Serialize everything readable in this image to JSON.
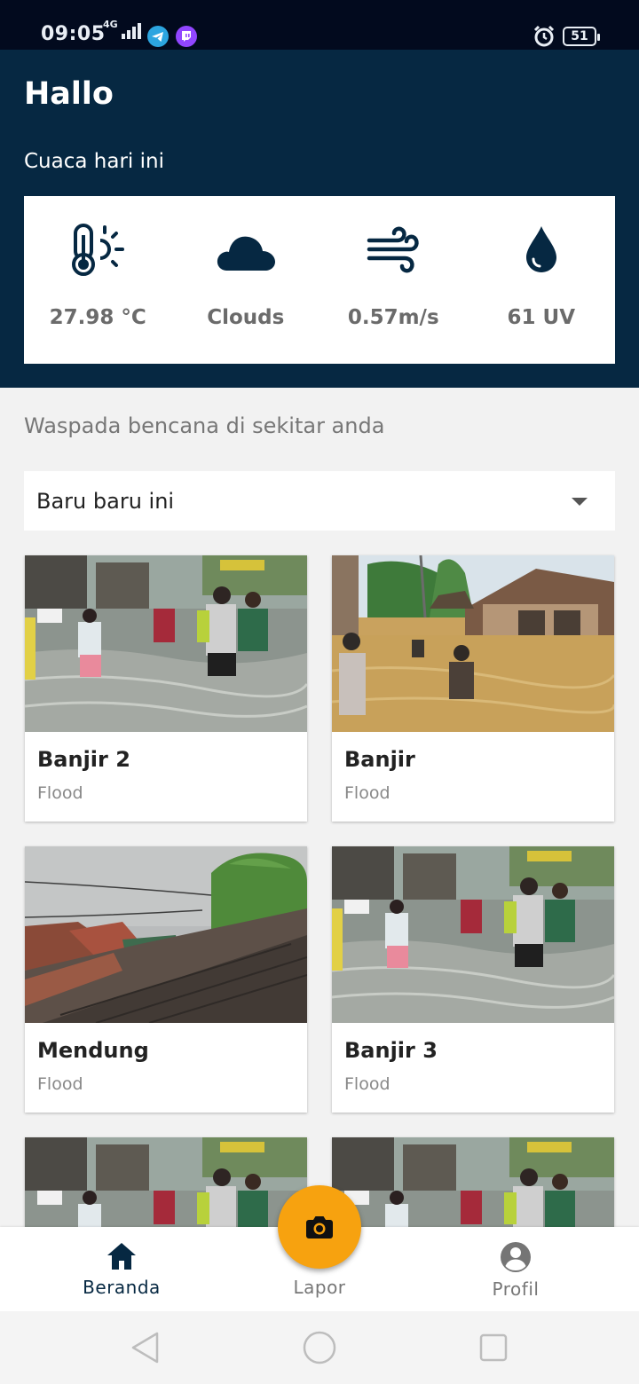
{
  "status": {
    "time": "09:05",
    "network": "4G",
    "battery": "51"
  },
  "header": {
    "greeting": "Hallo",
    "weather_title": "Cuaca hari ini"
  },
  "weather": [
    {
      "icon": "thermometer-sun-icon",
      "value": "27.98 °C"
    },
    {
      "icon": "cloud-icon",
      "value": "Clouds"
    },
    {
      "icon": "wind-icon",
      "value": "0.57m/s"
    },
    {
      "icon": "water-drop-icon",
      "value": "61 UV"
    }
  ],
  "section": {
    "alert_text": "Waspada bencana di sekitar anda",
    "filter_selected": "Baru baru ini"
  },
  "cards": [
    {
      "title": "Banjir 2",
      "subtitle": "Flood",
      "image": "flood-street-photo"
    },
    {
      "title": "Banjir",
      "subtitle": "Flood",
      "image": "flood-village-photo"
    },
    {
      "title": "Mendung",
      "subtitle": "Flood",
      "image": "cloudy-roof-photo"
    },
    {
      "title": "Banjir 3",
      "subtitle": "Flood",
      "image": "flood-street-photo"
    }
  ],
  "nav": {
    "home": "Beranda",
    "report": "Lapor",
    "profile": "Profil"
  },
  "colors": {
    "header_bg": "#062842",
    "accent": "#f7a20f",
    "status_bg": "#020a1e"
  }
}
